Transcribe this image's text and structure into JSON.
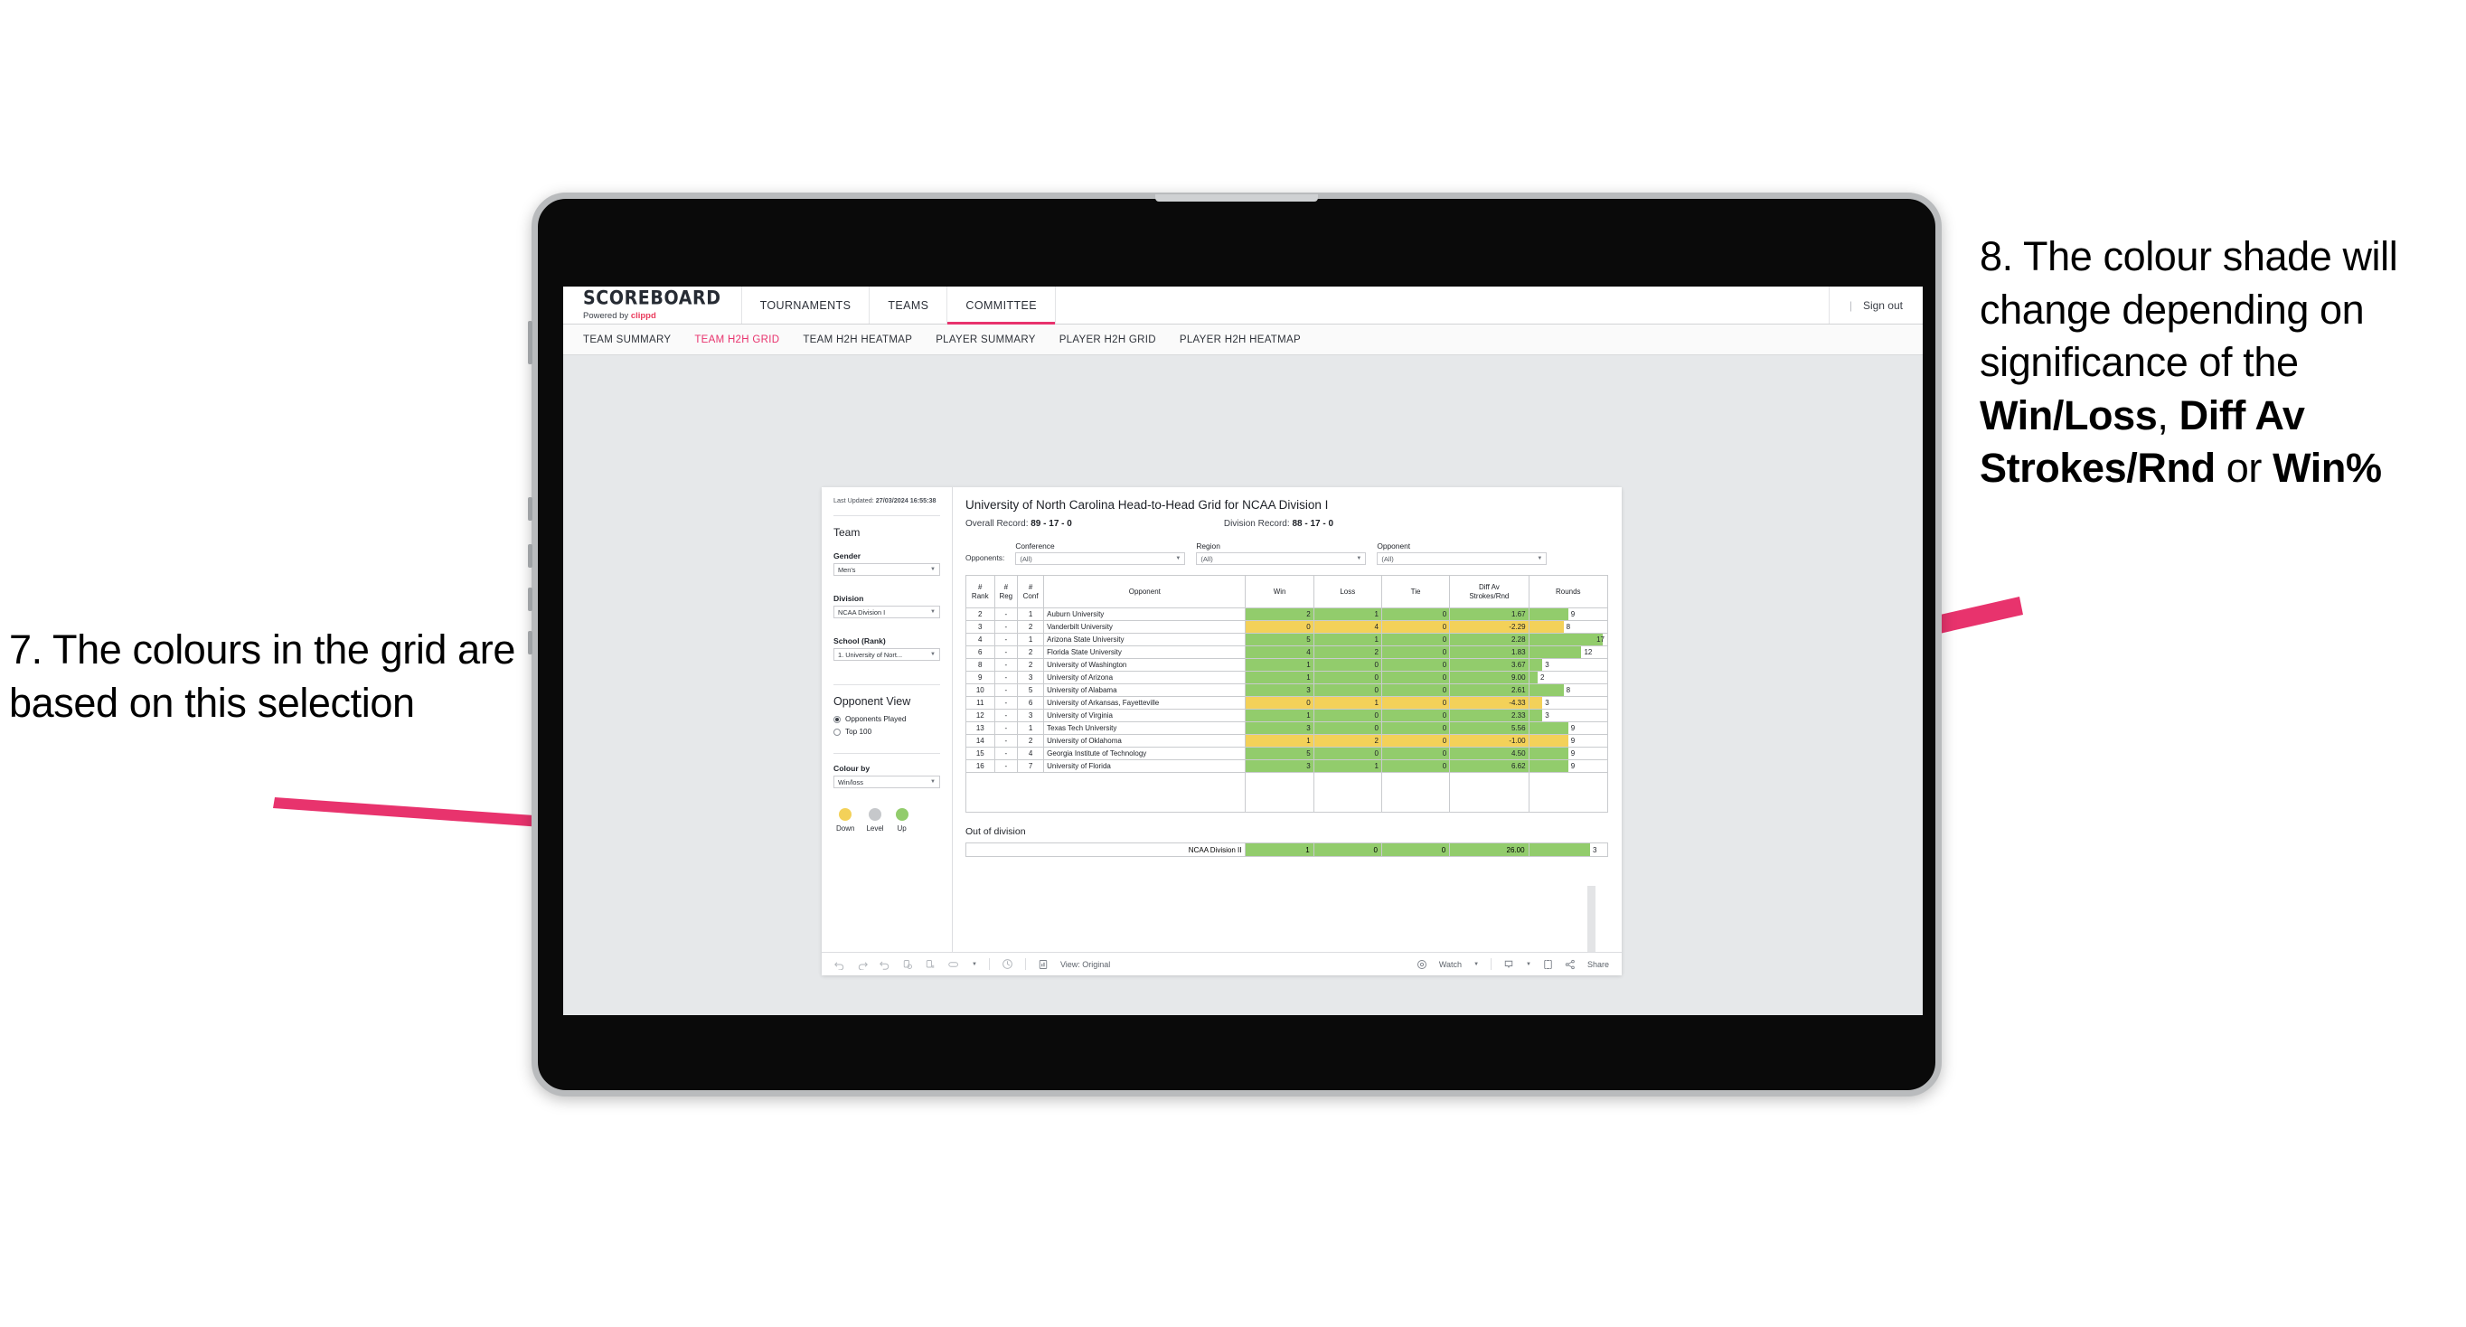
{
  "annotations": {
    "left": "7. The colours in the grid are based on this selection",
    "right_pre": "8. The colour shade will change depending on significance of the ",
    "right_b1": "Win/Loss",
    "right_mid1": ", ",
    "right_b2": "Diff Av Strokes/Rnd",
    "right_mid2": " or ",
    "right_b3": "Win%",
    "arrow_color": "#e8336d"
  },
  "app": {
    "brand_title": "SCOREBOARD",
    "brand_sub_pre": "Powered by ",
    "brand_sub_accent": "clippd",
    "nav": [
      {
        "label": "TOURNAMENTS",
        "active": false
      },
      {
        "label": "TEAMS",
        "active": false
      },
      {
        "label": "COMMITTEE",
        "active": true
      }
    ],
    "sign_out": "Sign out",
    "sign_out_divider": "|",
    "subnav": [
      {
        "label": "TEAM SUMMARY",
        "active": false
      },
      {
        "label": "TEAM H2H GRID",
        "active": true
      },
      {
        "label": "TEAM H2H HEATMAP",
        "active": false
      },
      {
        "label": "PLAYER SUMMARY",
        "active": false
      },
      {
        "label": "PLAYER H2H GRID",
        "active": false
      },
      {
        "label": "PLAYER H2H HEATMAP",
        "active": false
      }
    ],
    "accent": "#e8336d"
  },
  "sidebar": {
    "last_updated_label": "Last Updated: ",
    "last_updated_value": "27/03/2024 16:55:38",
    "team_title": "Team",
    "gender_label": "Gender",
    "gender_value": "Men's",
    "division_label": "Division",
    "division_value": "NCAA Division I",
    "school_label": "School (Rank)",
    "school_value": "1. University of Nort...",
    "opponent_view_title": "Opponent View",
    "radio_options": [
      {
        "label": "Opponents Played",
        "selected": true
      },
      {
        "label": "Top 100",
        "selected": false
      }
    ],
    "colour_by_label": "Colour by",
    "colour_by_value": "Win/loss",
    "legend": [
      {
        "label": "Down",
        "color": "#f3d159"
      },
      {
        "label": "Level",
        "color": "#c6c8cb"
      },
      {
        "label": "Up",
        "color": "#92cc6c"
      }
    ]
  },
  "viz": {
    "title": "University of North Carolina Head-to-Head Grid for NCAA Division I",
    "overall_label": "Overall Record: ",
    "overall_value": "89 - 17 - 0",
    "division_label": "Division Record: ",
    "division_value": "88 - 17 - 0",
    "opponents_label": "Opponents:",
    "filters": [
      {
        "label": "Conference",
        "value": "(All)"
      },
      {
        "label": "Region",
        "value": "(All)"
      },
      {
        "label": "Opponent",
        "value": "(All)"
      }
    ],
    "columns": [
      "# Rank",
      "# Reg",
      "# Conf",
      "Opponent",
      "Win",
      "Loss",
      "Tie",
      "Diff Av Strokes/Rnd",
      "Rounds"
    ],
    "columns_split": [
      {
        "l1": "#",
        "l2": "Rank"
      },
      {
        "l1": "#",
        "l2": "Reg"
      },
      {
        "l1": "#",
        "l2": "Conf"
      },
      {
        "l1": "Opponent",
        "l2": ""
      },
      {
        "l1": "Win",
        "l2": ""
      },
      {
        "l1": "Loss",
        "l2": ""
      },
      {
        "l1": "Tie",
        "l2": ""
      },
      {
        "l1": "Diff Av",
        "l2": "Strokes/Rnd"
      },
      {
        "l1": "Rounds",
        "l2": ""
      }
    ],
    "rows": [
      {
        "rank": "2",
        "reg": "-",
        "conf": "1",
        "opponent": "Auburn University",
        "win": "2",
        "loss": "1",
        "tie": "0",
        "diff": "1.67",
        "rounds": "9",
        "state": "win",
        "bar_pct": 50
      },
      {
        "rank": "3",
        "reg": "-",
        "conf": "2",
        "opponent": "Vanderbilt University",
        "win": "0",
        "loss": "4",
        "tie": "0",
        "diff": "-2.29",
        "rounds": "8",
        "state": "loss",
        "bar_pct": 44
      },
      {
        "rank": "4",
        "reg": "-",
        "conf": "1",
        "opponent": "Arizona State University",
        "win": "5",
        "loss": "1",
        "tie": "0",
        "diff": "2.28",
        "rounds": "17",
        "state": "win",
        "bar_pct": 94
      },
      {
        "rank": "6",
        "reg": "-",
        "conf": "2",
        "opponent": "Florida State University",
        "win": "4",
        "loss": "2",
        "tie": "0",
        "diff": "1.83",
        "rounds": "12",
        "state": "win",
        "bar_pct": 67
      },
      {
        "rank": "8",
        "reg": "-",
        "conf": "2",
        "opponent": "University of Washington",
        "win": "1",
        "loss": "0",
        "tie": "0",
        "diff": "3.67",
        "rounds": "3",
        "state": "win",
        "bar_pct": 17
      },
      {
        "rank": "9",
        "reg": "-",
        "conf": "3",
        "opponent": "University of Arizona",
        "win": "1",
        "loss": "0",
        "tie": "0",
        "diff": "9.00",
        "rounds": "2",
        "state": "win",
        "bar_pct": 11
      },
      {
        "rank": "10",
        "reg": "-",
        "conf": "5",
        "opponent": "University of Alabama",
        "win": "3",
        "loss": "0",
        "tie": "0",
        "diff": "2.61",
        "rounds": "8",
        "state": "win",
        "bar_pct": 44
      },
      {
        "rank": "11",
        "reg": "-",
        "conf": "6",
        "opponent": "University of Arkansas, Fayetteville",
        "win": "0",
        "loss": "1",
        "tie": "0",
        "diff": "-4.33",
        "rounds": "3",
        "state": "loss",
        "bar_pct": 17
      },
      {
        "rank": "12",
        "reg": "-",
        "conf": "3",
        "opponent": "University of Virginia",
        "win": "1",
        "loss": "0",
        "tie": "0",
        "diff": "2.33",
        "rounds": "3",
        "state": "win",
        "bar_pct": 17
      },
      {
        "rank": "13",
        "reg": "-",
        "conf": "1",
        "opponent": "Texas Tech University",
        "win": "3",
        "loss": "0",
        "tie": "0",
        "diff": "5.56",
        "rounds": "9",
        "state": "win",
        "bar_pct": 50
      },
      {
        "rank": "14",
        "reg": "-",
        "conf": "2",
        "opponent": "University of Oklahoma",
        "win": "1",
        "loss": "2",
        "tie": "0",
        "diff": "-1.00",
        "rounds": "9",
        "state": "loss",
        "bar_pct": 50
      },
      {
        "rank": "15",
        "reg": "-",
        "conf": "4",
        "opponent": "Georgia Institute of Technology",
        "win": "5",
        "loss": "0",
        "tie": "0",
        "diff": "4.50",
        "rounds": "9",
        "state": "win",
        "bar_pct": 50
      },
      {
        "rank": "16",
        "reg": "-",
        "conf": "7",
        "opponent": "University of Florida",
        "win": "3",
        "loss": "1",
        "tie": "0",
        "diff": "6.62",
        "rounds": "9",
        "state": "win",
        "bar_pct": 50
      }
    ],
    "out_of_division_title": "Out of division",
    "out_of_division_row": {
      "name": "NCAA Division II",
      "win": "1",
      "loss": "0",
      "tie": "0",
      "diff": "26.00",
      "rounds": "3",
      "state": "win",
      "bar_pct": 78
    },
    "toolbar": {
      "view_label": "View: Original",
      "watch_label": "Watch",
      "share_label": "Share",
      "icons": [
        "undo-icon",
        "redo-icon",
        "revert-icon",
        "refresh-data-icon",
        "pause-refresh-icon",
        "rectangle-select-icon",
        "chevron-down-icon",
        "zoom-history-icon",
        "view-original-icon",
        "watch-icon",
        "download-icon",
        "chevron-down-icon-2",
        "device-layout-icon",
        "share-icon"
      ]
    }
  },
  "chart_data": {
    "type": "table",
    "title": "University of North Carolina Head-to-Head Grid for NCAA Division I",
    "columns": [
      "# Rank",
      "# Reg",
      "# Conf",
      "Opponent",
      "Win",
      "Loss",
      "Tie",
      "Diff Av Strokes/Rnd",
      "Rounds"
    ],
    "rows": [
      [
        "2",
        "-",
        "1",
        "Auburn University",
        2,
        1,
        0,
        1.67,
        9
      ],
      [
        "3",
        "-",
        "2",
        "Vanderbilt University",
        0,
        4,
        0,
        -2.29,
        8
      ],
      [
        "4",
        "-",
        "1",
        "Arizona State University",
        5,
        1,
        0,
        2.28,
        17
      ],
      [
        "6",
        "-",
        "2",
        "Florida State University",
        4,
        2,
        0,
        1.83,
        12
      ],
      [
        "8",
        "-",
        "2",
        "University of Washington",
        1,
        0,
        0,
        3.67,
        3
      ],
      [
        "9",
        "-",
        "3",
        "University of Arizona",
        1,
        0,
        0,
        9.0,
        2
      ],
      [
        "10",
        "-",
        "5",
        "University of Alabama",
        3,
        0,
        0,
        2.61,
        8
      ],
      [
        "11",
        "-",
        "6",
        "University of Arkansas, Fayetteville",
        0,
        1,
        0,
        -4.33,
        3
      ],
      [
        "12",
        "-",
        "3",
        "University of Virginia",
        1,
        0,
        0,
        2.33,
        3
      ],
      [
        "13",
        "-",
        "1",
        "Texas Tech University",
        3,
        0,
        0,
        5.56,
        9
      ],
      [
        "14",
        "-",
        "2",
        "University of Oklahoma",
        1,
        2,
        0,
        -1.0,
        9
      ],
      [
        "15",
        "-",
        "4",
        "Georgia Institute of Technology",
        5,
        0,
        0,
        4.5,
        9
      ],
      [
        "16",
        "-",
        "7",
        "University of Florida",
        3,
        1,
        0,
        6.62,
        9
      ]
    ],
    "out_of_division": [
      [
        "NCAA Division II",
        1,
        0,
        0,
        26.0,
        3
      ]
    ],
    "colour_encoding": "Win/loss",
    "legend": {
      "Down": "#f3d159",
      "Level": "#c6c8cb",
      "Up": "#92cc6c"
    },
    "overall_record": "89 - 17 - 0",
    "division_record": "88 - 17 - 0"
  }
}
